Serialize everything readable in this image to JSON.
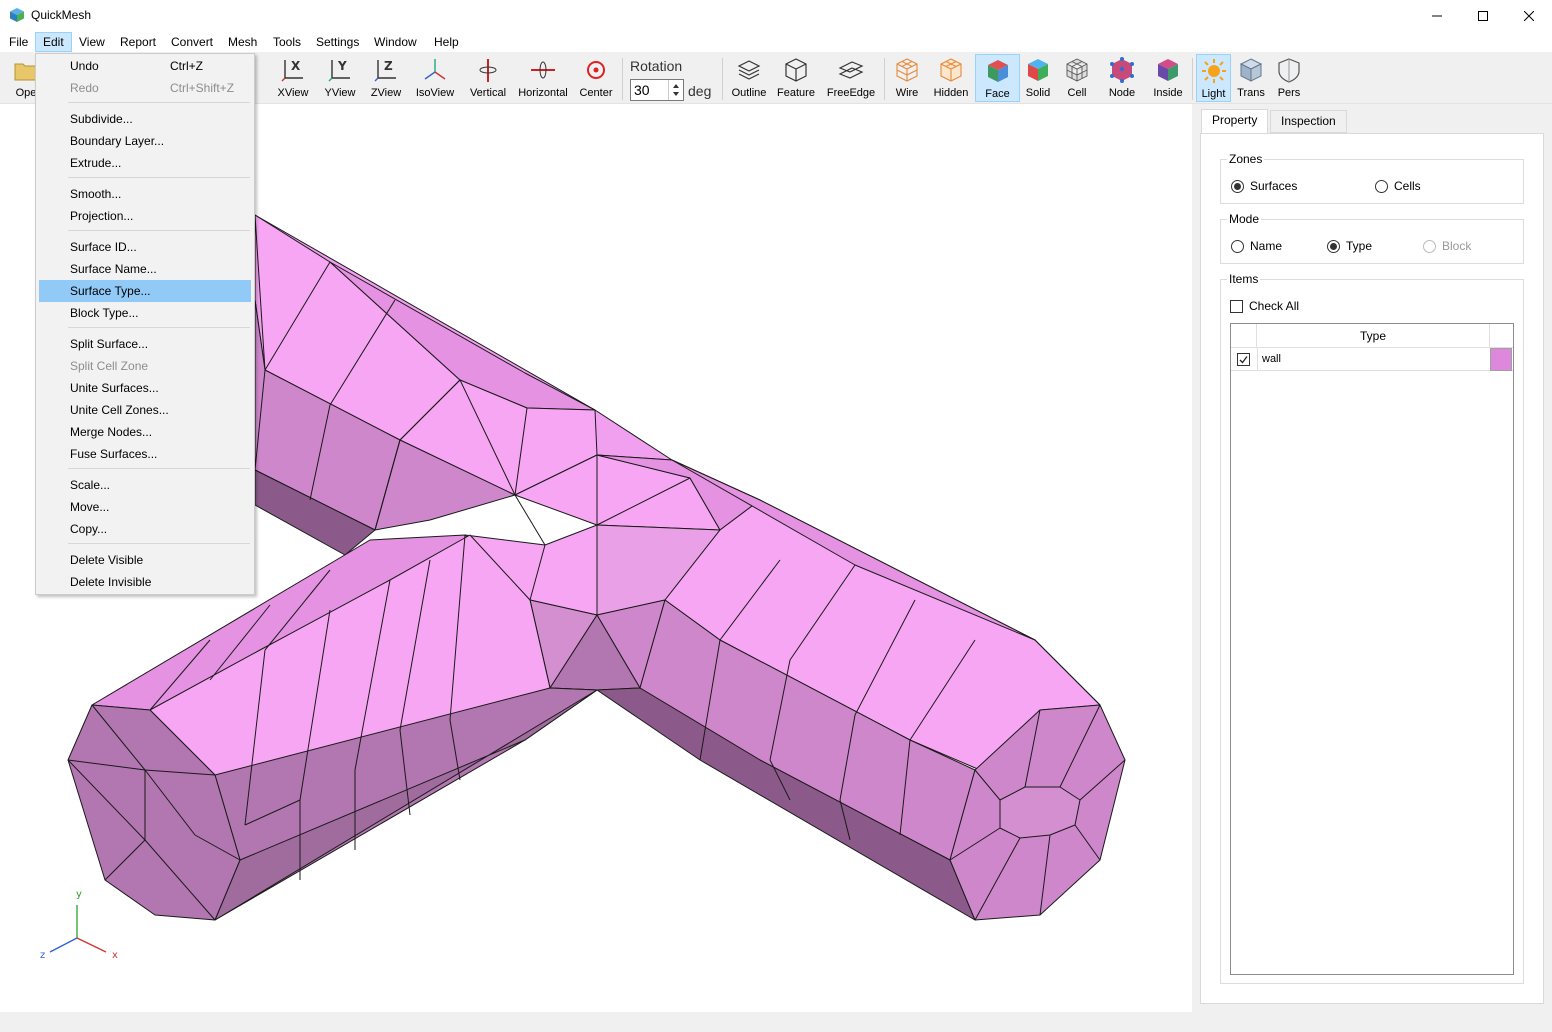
{
  "window": {
    "title": "QuickMesh",
    "icon": "quickmesh-cube-icon",
    "controls": [
      "minimize-icon",
      "maximize-icon",
      "close-icon"
    ]
  },
  "menubar": {
    "items": [
      "File",
      "Edit",
      "View",
      "Report",
      "Convert",
      "Mesh",
      "Tools",
      "Settings",
      "Window",
      "Help"
    ],
    "active": "Edit"
  },
  "toolbar": {
    "open_label_partial": "Ope",
    "buttons": [
      {
        "label": "XView",
        "icon": "x-axis-view-icon"
      },
      {
        "label": "YView",
        "icon": "y-axis-view-icon"
      },
      {
        "label": "ZView",
        "icon": "z-axis-view-icon"
      },
      {
        "label": "IsoView",
        "icon": "iso-view-icon"
      },
      {
        "label": "Vertical",
        "icon": "vertical-rotate-icon"
      },
      {
        "label": "Horizontal",
        "icon": "horizontal-rotate-icon"
      },
      {
        "label": "Center",
        "icon": "center-target-icon"
      },
      {
        "label": "Outline",
        "icon": "outline-layers-icon"
      },
      {
        "label": "Feature",
        "icon": "feature-cube-icon"
      },
      {
        "label": "FreeEdge",
        "icon": "free-edge-icon"
      },
      {
        "label": "Wire",
        "icon": "wire-cube-icon"
      },
      {
        "label": "Hidden",
        "icon": "hidden-cube-icon"
      },
      {
        "label": "Face",
        "icon": "face-cube-icon",
        "checked": true
      },
      {
        "label": "Solid",
        "icon": "solid-cube-icon"
      },
      {
        "label": "Cell",
        "icon": "cell-mesh-icon"
      },
      {
        "label": "Node",
        "icon": "node-cube-icon"
      },
      {
        "label": "Inside",
        "icon": "inside-cube-icon"
      },
      {
        "label": "Light",
        "icon": "light-sun-icon",
        "checked": true
      },
      {
        "label": "Trans",
        "icon": "transparent-cube-icon"
      },
      {
        "label": "Pers",
        "icon": "perspective-shield-icon"
      }
    ],
    "rotation": {
      "label": "Rotation",
      "value": "30",
      "unit": "deg"
    }
  },
  "edit_menu": {
    "groups": [
      [
        {
          "label": "Undo",
          "shortcut": "Ctrl+Z"
        },
        {
          "label": "Redo",
          "shortcut": "Ctrl+Shift+Z",
          "disabled": true
        }
      ],
      [
        {
          "label": "Subdivide..."
        },
        {
          "label": "Boundary Layer..."
        },
        {
          "label": "Extrude..."
        }
      ],
      [
        {
          "label": "Smooth..."
        },
        {
          "label": "Projection..."
        }
      ],
      [
        {
          "label": "Surface ID..."
        },
        {
          "label": "Surface Name..."
        },
        {
          "label": "Surface Type...",
          "highlighted": true
        },
        {
          "label": "Block Type..."
        }
      ],
      [
        {
          "label": "Split Surface..."
        },
        {
          "label": "Split Cell Zone",
          "disabled": true
        },
        {
          "label": "Unite Surfaces..."
        },
        {
          "label": "Unite Cell Zones..."
        },
        {
          "label": "Merge Nodes..."
        },
        {
          "label": "Fuse Surfaces..."
        }
      ],
      [
        {
          "label": "Scale..."
        },
        {
          "label": "Move..."
        },
        {
          "label": "Copy..."
        }
      ],
      [
        {
          "label": "Delete Visible"
        },
        {
          "label": "Delete Invisible"
        }
      ]
    ]
  },
  "viewport": {
    "axis_labels": {
      "y": "y",
      "z": "z",
      "x": "x"
    },
    "mesh_colors": {
      "light": "#f7a6f4",
      "mid": "#e492e1",
      "shade": "#cf87cc",
      "dark": "#b276b0",
      "darker": "#8c5a8a"
    }
  },
  "panel": {
    "tabs": [
      "Property",
      "Inspection"
    ],
    "active_tab": "Property",
    "zones": {
      "title": "Zones",
      "options": [
        "Surfaces",
        "Cells"
      ],
      "selected": "Surfaces"
    },
    "mode": {
      "title": "Mode",
      "options": [
        "Name",
        "Type",
        "Block"
      ],
      "selected": "Type",
      "disabled": [
        "Block"
      ]
    },
    "items": {
      "title": "Items",
      "check_all": "Check All",
      "column": "Type",
      "rows": [
        {
          "name": "wall",
          "checked": true,
          "color": "#dd88dd"
        }
      ]
    }
  }
}
